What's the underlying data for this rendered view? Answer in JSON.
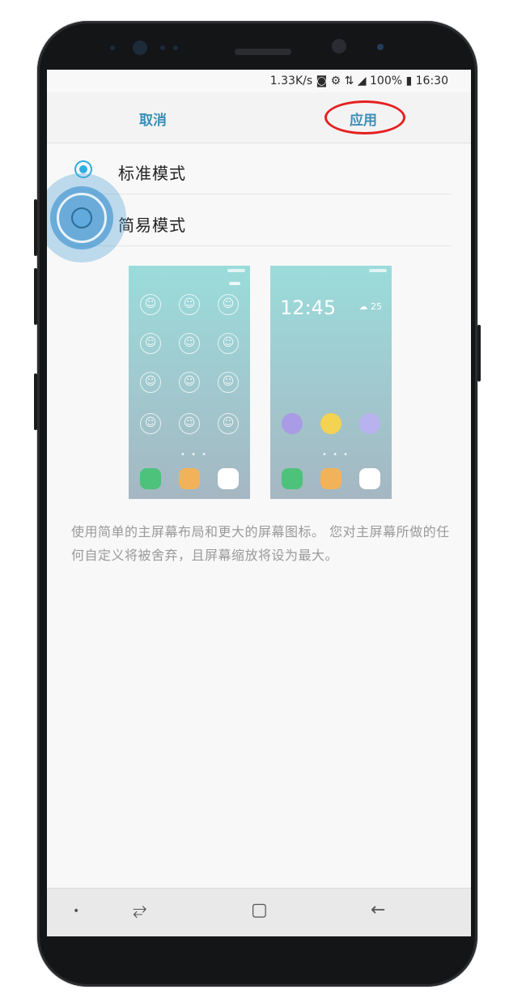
{
  "status_bar": {
    "text": "1.33K/s ◙ ⚙ ⇅ ◢ 100% ▮ 16:30"
  },
  "top_bar": {
    "cancel_label": "取消",
    "apply_label": "应用"
  },
  "options": [
    {
      "label": "标准模式",
      "selected": true
    },
    {
      "label": "简易模式",
      "selected": false
    }
  ],
  "preview_easy": {
    "dock_icons": [
      "phone-icon",
      "message-icon",
      "apps-icon"
    ]
  },
  "preview_standard": {
    "clock": "12:45",
    "weather": "☁ 25",
    "apps_icons": [
      "galaxy-icon",
      "clover-icon",
      "camera-icon"
    ],
    "dock_icons": [
      "phone-icon",
      "message-icon",
      "apps-icon"
    ]
  },
  "description": "使用简单的主屏幕布局和更大的屏幕图标。 您对主屏幕所做的任何自定义将被舍弃，且屏幕缩放将设为最大。",
  "nav_bar": {
    "dot": "•",
    "recent": "⥂",
    "home": "▢",
    "back": "←"
  },
  "colors": {
    "accent": "#2eaee0",
    "action_text": "#3a8fb8",
    "highlight_circle": "#e62020"
  }
}
